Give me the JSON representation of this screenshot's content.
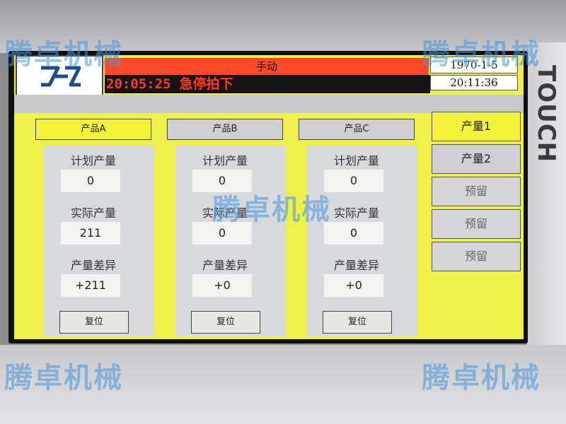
{
  "header": {
    "mode_label": "手动",
    "status_time": "20:05:25",
    "status_message": "急停拍下",
    "date": "1970-1-5",
    "clock": "20:11:36"
  },
  "panels": [
    {
      "title": "产品A",
      "active": true,
      "planned_label": "计划产量",
      "planned_value": "0",
      "actual_label": "实际产量",
      "actual_value": "211",
      "diff_label": "产量差异",
      "diff_value": "+211",
      "reset_label": "复位"
    },
    {
      "title": "产品B",
      "active": false,
      "planned_label": "计划产量",
      "planned_value": "0",
      "actual_label": "实际产量",
      "actual_value": "0",
      "diff_label": "产量差异",
      "diff_value": "+0",
      "reset_label": "复位"
    },
    {
      "title": "产品C",
      "active": false,
      "planned_label": "计划产量",
      "planned_value": "0",
      "actual_label": "实际产量",
      "actual_value": "0",
      "diff_label": "产量差异",
      "diff_value": "+0",
      "reset_label": "复位"
    }
  ],
  "nav": [
    {
      "label": "产量1",
      "active": true
    },
    {
      "label": "产量2",
      "active": false
    },
    {
      "label": "预留",
      "active": false
    },
    {
      "label": "预留",
      "active": false
    },
    {
      "label": "预留",
      "active": false
    }
  ],
  "bezel_brand": "TOUCH",
  "watermark": "腾卓机械",
  "colors": {
    "screen_bg": "#eef04a",
    "mode_bar": "#ff4a2a",
    "status_text": "#ff3a18",
    "active_tab": "#f4f23a"
  }
}
